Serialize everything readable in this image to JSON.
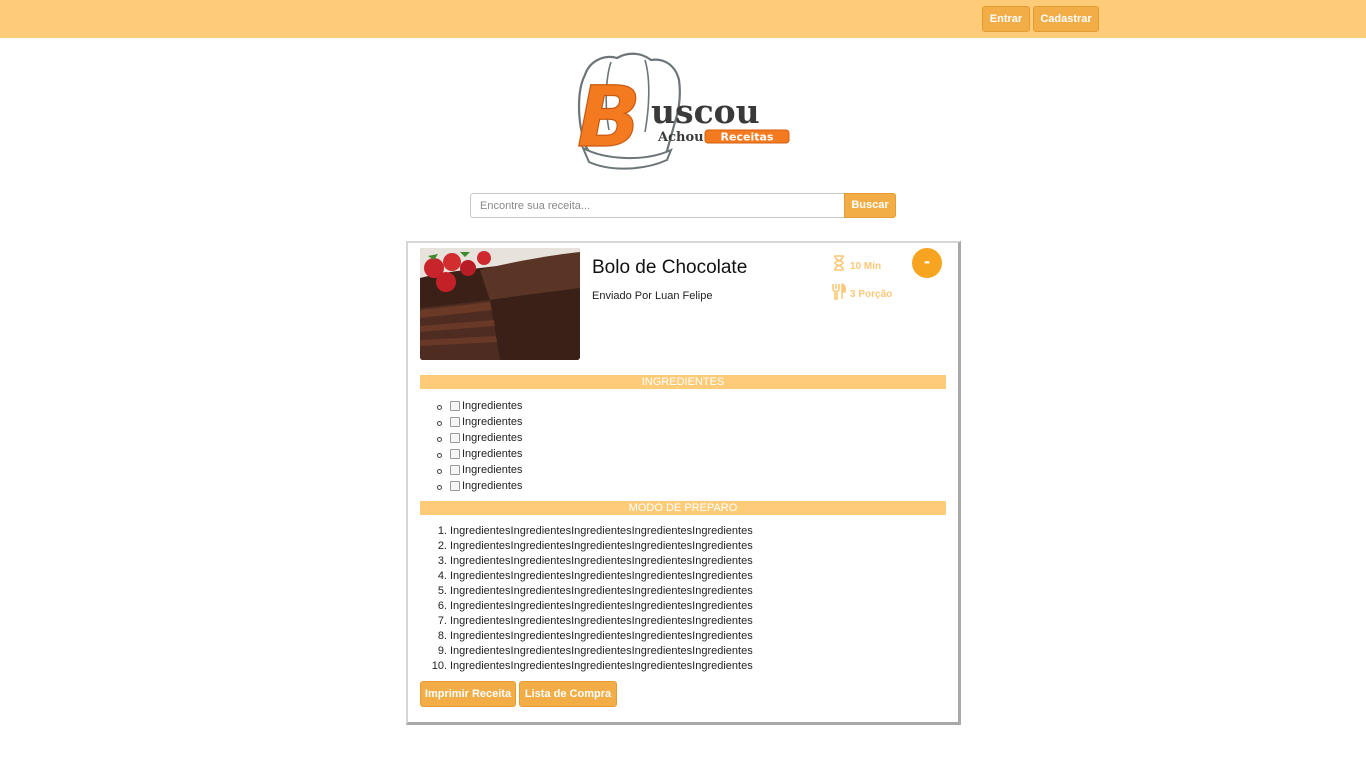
{
  "header": {
    "login_label": "Entrar",
    "signup_label": "Cadastrar"
  },
  "logo": {
    "title": "Buscou",
    "subtitle": "Achou",
    "badge": "Receitas"
  },
  "search": {
    "placeholder": "Encontre sua receita...",
    "button_label": "Buscar"
  },
  "recipe": {
    "title": "Bolo de Chocolate",
    "author": "Enviado Por Luan Felipe",
    "time": "10 Min",
    "servings": "3 Porção",
    "toggle_label": "-",
    "ingredients_heading": "INGREDIENTES",
    "ingredients": [
      "Ingredientes",
      "Ingredientes",
      "Ingredientes",
      "Ingredientes",
      "Ingredientes",
      "Ingredientes"
    ],
    "steps_heading": "MODO DE PREPARO",
    "steps": [
      {
        "num": "1.",
        "text": "IngredientesIngredientesIngredientesIngredientesIngredientes"
      },
      {
        "num": "2.",
        "text": "IngredientesIngredientesIngredientesIngredientesIngredientes"
      },
      {
        "num": "3.",
        "text": "IngredientesIngredientesIngredientesIngredientesIngredientes"
      },
      {
        "num": "4.",
        "text": "IngredientesIngredientesIngredientesIngredientesIngredientes"
      },
      {
        "num": "5.",
        "text": "IngredientesIngredientesIngredientesIngredientesIngredientes"
      },
      {
        "num": "6.",
        "text": "IngredientesIngredientesIngredientesIngredientesIngredientes"
      },
      {
        "num": "7.",
        "text": "IngredientesIngredientesIngredientesIngredientesIngredientes"
      },
      {
        "num": "8.",
        "text": "IngredientesIngredientesIngredientesIngredientesIngredientes"
      },
      {
        "num": "9.",
        "text": "IngredientesIngredientesIngredientesIngredientesIngredientes"
      },
      {
        "num": "10.",
        "text": "IngredientesIngredientesIngredientesIngredientesIngredientes"
      }
    ],
    "print_label": "Imprimir Receita",
    "shopping_label": "Lista de Compra"
  },
  "icons": {
    "time": "hourglass-icon",
    "servings": "fork-knife-icon"
  },
  "colors": {
    "header_bg": "#fecb78",
    "button_bg": "#f2ad47",
    "accent": "#f7a520",
    "logo_orange": "#f47a20"
  }
}
